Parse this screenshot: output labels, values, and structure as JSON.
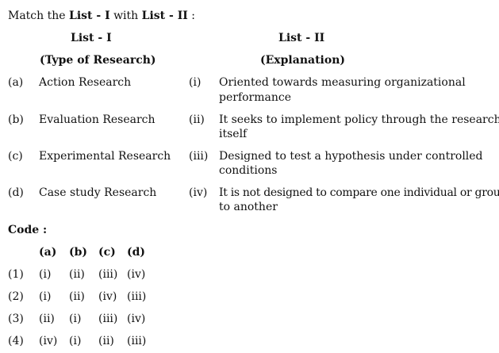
{
  "instruction": {
    "prefix": "Match the ",
    "list1": "List - I",
    "middle": " with ",
    "list2": "List - II",
    "suffix": " :"
  },
  "headers": {
    "list1_title": "List - I",
    "list1_sub": "(Type of Research)",
    "list2_title": "List - II",
    "list2_sub": "(Explanation)"
  },
  "list1": [
    {
      "label": "(a)",
      "text": "Action Research"
    },
    {
      "label": "(b)",
      "text": "Evaluation Research"
    },
    {
      "label": "(c)",
      "text": "Experimental Research"
    },
    {
      "label": "(d)",
      "text": "Case study Research"
    }
  ],
  "list2": [
    {
      "label": "(i)",
      "line1": "Oriented towards measuring organizational",
      "line2": "performance"
    },
    {
      "label": "(ii)",
      "line1": "It seeks to implement policy through the research",
      "line2": "itself"
    },
    {
      "label": "(iii)",
      "line1": "Designed to test a hypothesis under controlled",
      "line2": "conditions"
    },
    {
      "label": "(iv)",
      "line1": "It is not designed to compare one individual or group",
      "line2": "to another"
    }
  ],
  "code": {
    "title": "Code :",
    "headers": [
      "(a)",
      "(b)",
      "(c)",
      "(d)"
    ],
    "options": [
      {
        "num": "(1)",
        "values": [
          "(i)",
          "(ii)",
          "(iii)",
          "(iv)"
        ]
      },
      {
        "num": "(2)",
        "values": [
          "(i)",
          "(ii)",
          "(iv)",
          "(iii)"
        ]
      },
      {
        "num": "(3)",
        "values": [
          "(ii)",
          "(i)",
          "(iii)",
          "(iv)"
        ]
      },
      {
        "num": "(4)",
        "values": [
          "(iv)",
          "(i)",
          "(ii)",
          "(iii)"
        ]
      }
    ]
  }
}
